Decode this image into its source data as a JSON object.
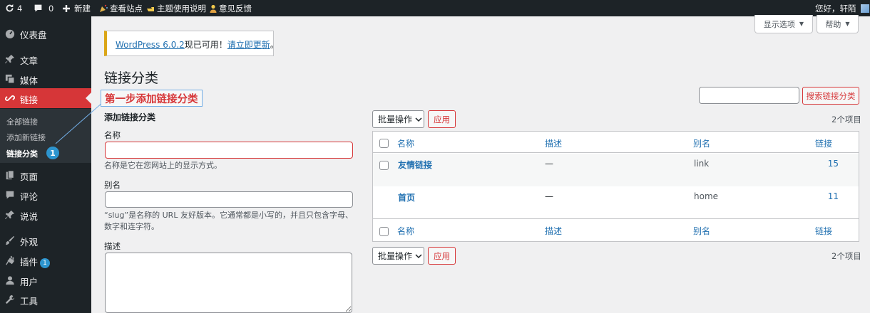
{
  "adminbar": {
    "updates_count": "4",
    "comments_count": "0",
    "new_label": "新建",
    "view_site_label": "查看站点",
    "theme_guide_label": "主题使用说明",
    "feedback_label": "意见反馈",
    "greeting": "您好，轩陌"
  },
  "sidebar": {
    "dashboard": "仪表盘",
    "posts": "文章",
    "media": "媒体",
    "links": "链接",
    "submenu": [
      "全部链接",
      "添加新链接",
      "链接分类"
    ],
    "pages": "页面",
    "comments": "评论",
    "talk": "说说",
    "appearance": "外观",
    "plugins": "插件",
    "plugins_badge": "1",
    "users": "用户",
    "tools": "工具"
  },
  "step_badge": "1",
  "screen_options": "显示选项",
  "help": "帮助",
  "notice": {
    "version_link": "WordPress 6.0.2",
    "text": "现已可用！",
    "update_link": "请立即更新",
    "end": "。"
  },
  "page_title": "链接分类",
  "annotation": "第一步添加链接分类",
  "form": {
    "title": "添加链接分类",
    "name_label": "名称",
    "name_value": "",
    "name_help": "名称是它在您网站上的显示方式。",
    "slug_label": "别名",
    "slug_value": "",
    "slug_help": "“slug”是名称的 URL 友好版本。它通常都是小写的，并且只包含字母、数字和连字符。",
    "desc_label": "描述"
  },
  "search_button": "搜索链接分类",
  "bulk_action": "批量操作",
  "apply": "应用",
  "items_count": "2个项目",
  "table": {
    "headers": [
      "名称",
      "描述",
      "别名",
      "链接"
    ],
    "rows": [
      {
        "name": "友情链接",
        "description": "—",
        "slug": "link",
        "count": "15"
      },
      {
        "name": "首页",
        "description": "—",
        "slug": "home",
        "count": "11"
      }
    ]
  },
  "colors": {
    "accent": "#d63638",
    "link": "#2271b1",
    "admin_dark": "#1d2327",
    "badge": "#2d95cf",
    "notice": "#dba617"
  }
}
